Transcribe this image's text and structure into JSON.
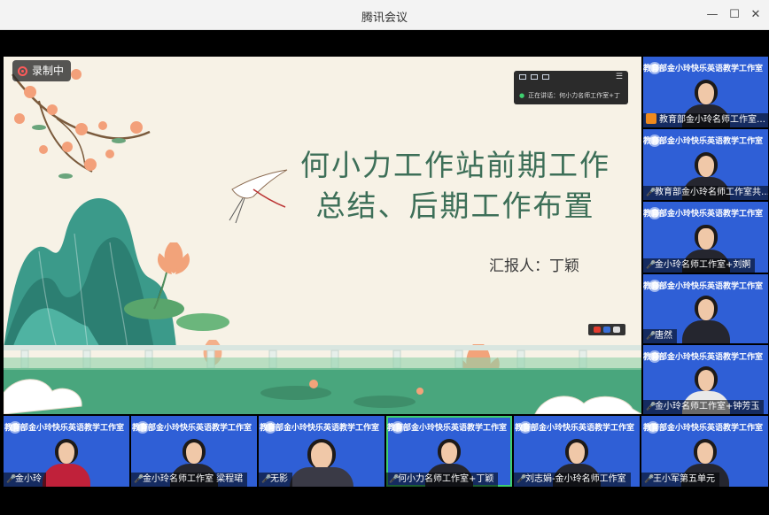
{
  "window": {
    "title": "腾讯会议",
    "minimize_icon": "minimize-icon",
    "maximize_icon": "maximize-icon",
    "close_icon": "close-icon"
  },
  "recording": {
    "label": "录制中"
  },
  "slide": {
    "title_line1": "何小力工作站前期工作",
    "title_line2": "总结、后期工作布置",
    "reporter": "汇报人：丁颖"
  },
  "speaking_panel": {
    "text": "正在讲话：何小力名师工作室+丁"
  },
  "tile_banner": "教育部金小玲快乐英语教学工作室",
  "right_tiles": [
    {
      "name": "教育部金小玲名师工作室…",
      "muted": false
    },
    {
      "name": "教育部金小玲名师工作室共…",
      "muted": false
    },
    {
      "name": "金小玲名师工作室+刘婀",
      "muted": false
    },
    {
      "name": "唐然",
      "muted": false
    },
    {
      "name": "金小玲名师工作室+钟芳玉",
      "muted": false
    }
  ],
  "bottom_tiles": [
    {
      "name": "金小玲",
      "muted": false
    },
    {
      "name": "金小玲名师工作室 梁程珺",
      "muted": false
    },
    {
      "name": "无影",
      "muted": false
    },
    {
      "name": "何小力名师工作室+丁颖",
      "muted": false,
      "active": true
    },
    {
      "name": "刘志娟-金小玲名师工作室",
      "muted": false
    },
    {
      "name": "王小军第五单元",
      "muted": false
    }
  ],
  "colors": {
    "accent_green": "#3ecf6f",
    "tile_blue": "#2f5fd6",
    "slide_title": "#3d6f58"
  }
}
